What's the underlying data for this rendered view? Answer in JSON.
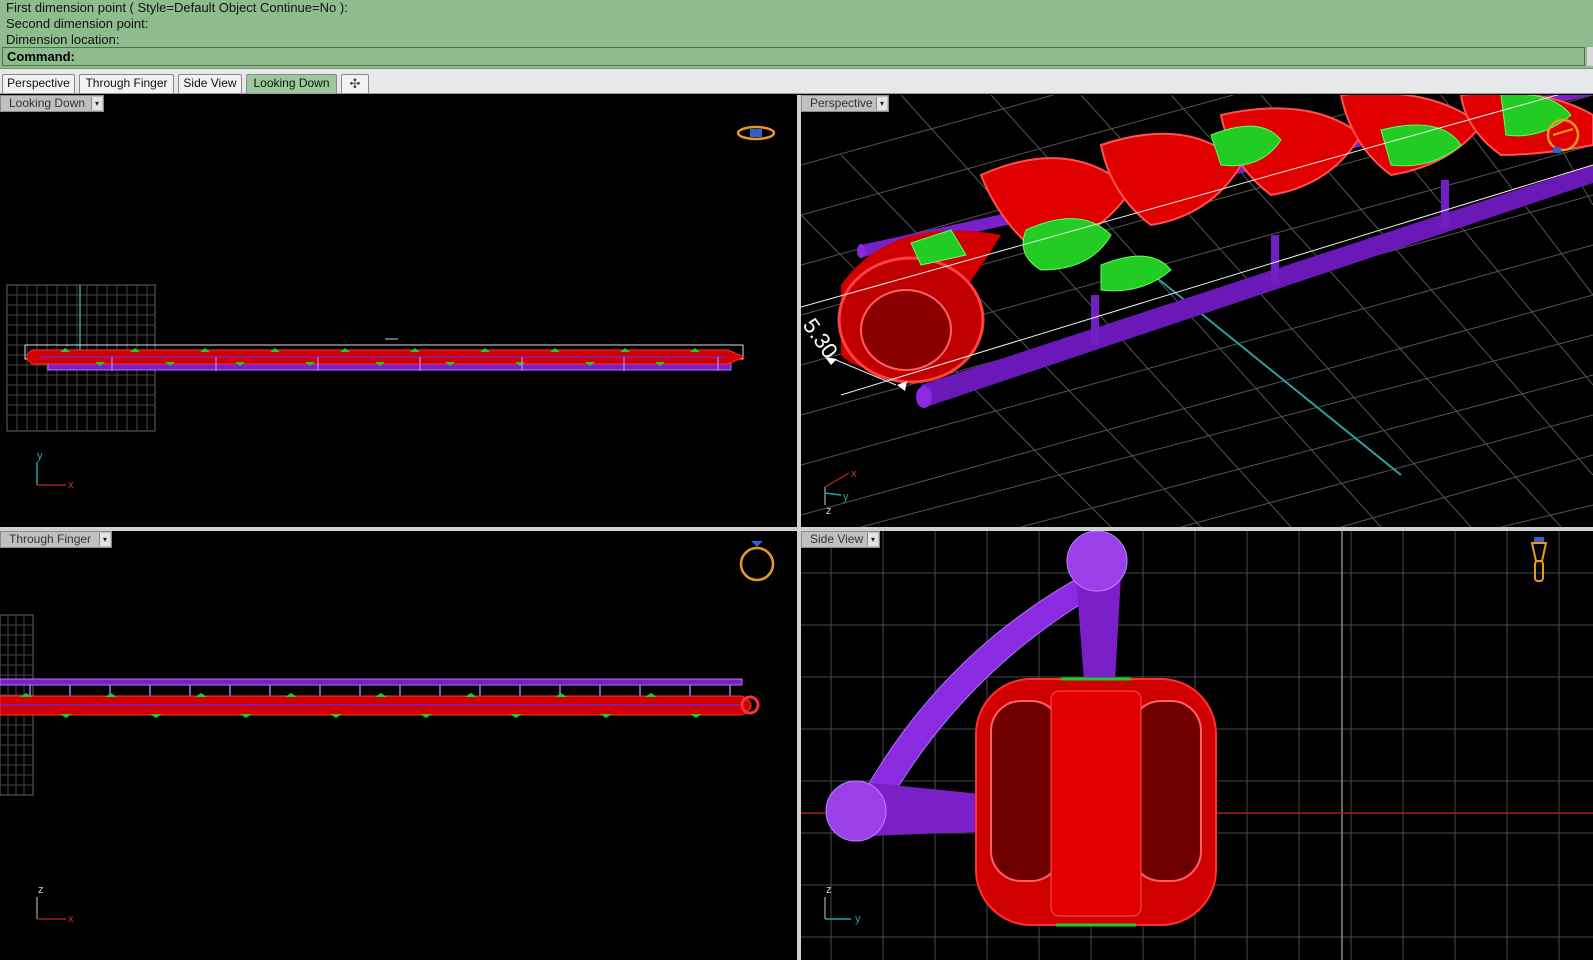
{
  "command_history": [
    "First dimension point ( Style=Default  Object  Continue=No ):",
    "Second dimension point:",
    "Dimension location:"
  ],
  "command_prompt": {
    "label": "Command:",
    "value": ""
  },
  "tabs": [
    {
      "label": "Perspective",
      "active": false
    },
    {
      "label": "Through Finger",
      "active": false
    },
    {
      "label": "Side View",
      "active": false
    },
    {
      "label": "Looking Down",
      "active": true
    }
  ],
  "add_tab_glyph": "✣",
  "dropdown_glyph": "▾",
  "viewports": {
    "top": {
      "title": "Looking Down",
      "axes": {
        "v": "y",
        "h": "x"
      },
      "nav_icon": "ring-top-icon"
    },
    "perspective": {
      "title": "Perspective",
      "axes": {
        "v": "z",
        "a": "x",
        "b": "y"
      },
      "nav_icon": "ring-persp-icon",
      "dimension": "5.30"
    },
    "front": {
      "title": "Through Finger",
      "axes": {
        "v": "z",
        "h": "x"
      },
      "nav_icon": "ring-front-icon"
    },
    "right": {
      "title": "Side View",
      "axes": {
        "v": "z",
        "h": "y"
      },
      "nav_icon": "ring-side-icon"
    }
  },
  "colors": {
    "command_bg": "#8fbc8f",
    "active_tab": "#9cc89c",
    "metal_red": "#e00000",
    "gem_green": "#22cc22",
    "prong_purple": "#8a2be2",
    "grid": "#555555",
    "axis_x": "#a02020",
    "axis_y": "#2aa0a0"
  }
}
